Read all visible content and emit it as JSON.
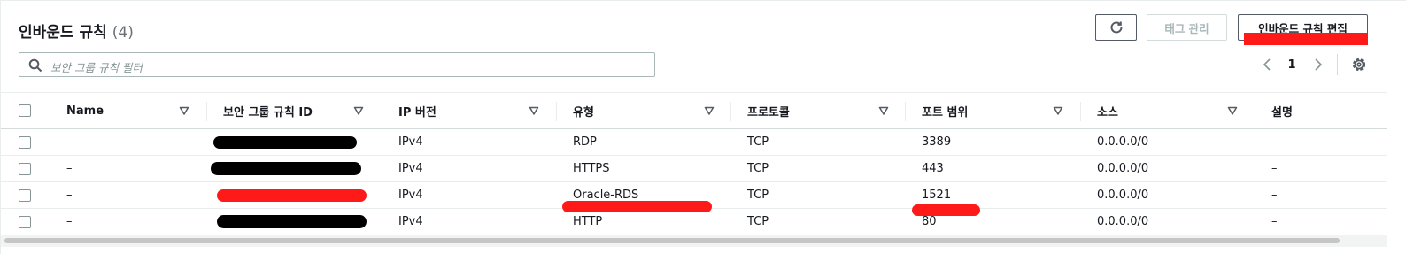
{
  "header": {
    "title": "인바운드 규칙",
    "count": "(4)",
    "refresh_icon": "refresh-icon",
    "tags_label": "태그 관리",
    "edit_label": "인바운드 규칙 편집"
  },
  "search": {
    "placeholder": "보안 그룹 규칙 필터",
    "icon": "search-icon"
  },
  "pagination": {
    "page": "1",
    "prev_icon": "chevron-left-icon",
    "next_icon": "chevron-right-icon",
    "settings_icon": "gear-icon"
  },
  "table": {
    "columns": [
      "Name",
      "보안 그룹 규칙 ID",
      "IP 버전",
      "유형",
      "프로토콜",
      "포트 범위",
      "소스",
      "설명"
    ],
    "rows": [
      {
        "name": "–",
        "rule_id": "[redacted]",
        "ip_version": "IPv4",
        "type": "RDP",
        "protocol": "TCP",
        "port_range": "3389",
        "source": "0.0.0.0/0",
        "description": "–"
      },
      {
        "name": "–",
        "rule_id": "[redacted]",
        "ip_version": "IPv4",
        "type": "HTTPS",
        "protocol": "TCP",
        "port_range": "443",
        "source": "0.0.0.0/0",
        "description": "–"
      },
      {
        "name": "–",
        "rule_id": "[redacted]",
        "ip_version": "IPv4",
        "type": "Oracle-RDS",
        "protocol": "TCP",
        "port_range": "1521",
        "source": "0.0.0.0/0",
        "description": "–"
      },
      {
        "name": "–",
        "rule_id": "[redacted]",
        "ip_version": "IPv4",
        "type": "HTTP",
        "protocol": "TCP",
        "port_range": "80",
        "source": "0.0.0.0/0",
        "description": "–"
      }
    ]
  },
  "colors": {
    "text": "#16191f",
    "muted": "#687078",
    "border": "#d5dbdb",
    "redact_black": "#000000",
    "annotation_red": "#ff1a1a"
  }
}
